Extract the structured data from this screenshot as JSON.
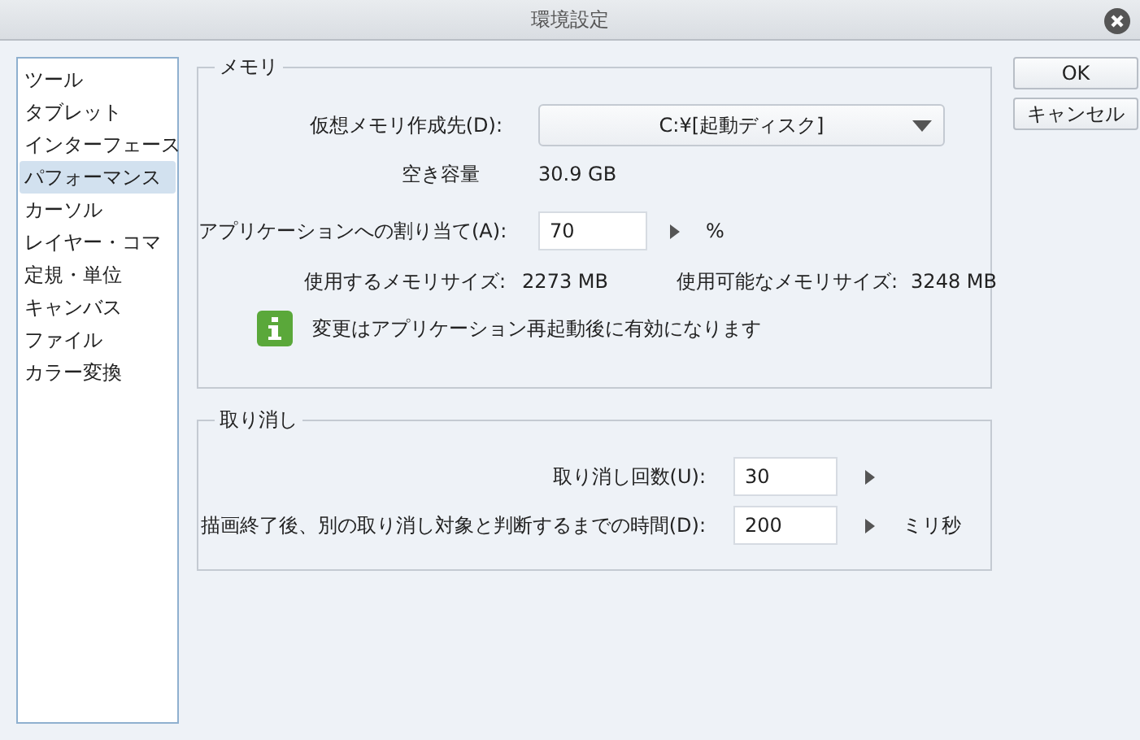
{
  "window": {
    "title": "環境設定"
  },
  "sidebar": {
    "items": [
      {
        "label": "ツール",
        "selected": false
      },
      {
        "label": "タブレット",
        "selected": false
      },
      {
        "label": "インターフェース",
        "selected": false
      },
      {
        "label": "パフォーマンス",
        "selected": true
      },
      {
        "label": "カーソル",
        "selected": false
      },
      {
        "label": "レイヤー・コマ",
        "selected": false
      },
      {
        "label": "定規・単位",
        "selected": false
      },
      {
        "label": "キャンバス",
        "selected": false
      },
      {
        "label": "ファイル",
        "selected": false
      },
      {
        "label": "カラー変換",
        "selected": false
      }
    ]
  },
  "memory": {
    "title": "メモリ",
    "location_label": "仮想メモリ作成先(D):",
    "location_value": "C:¥[起動ディスク]",
    "free_label": "空き容量",
    "free_value": "30.9 GB",
    "alloc_label": "アプリケーションへの割り当て(A):",
    "alloc_value": "70",
    "alloc_unit": "%",
    "used_label": "使用するメモリサイズ:",
    "used_value": "2273 MB",
    "available_label": "使用可能なメモリサイズ:",
    "available_value": "3248 MB",
    "info": "変更はアプリケーション再起動後に有効になります"
  },
  "undo": {
    "title": "取り消し",
    "count_label": "取り消し回数(U):",
    "count_value": "30",
    "time_label": "描画終了後、別の取り消し対象と判断するまでの時間(D):",
    "time_value": "200",
    "time_unit": "ミリ秒"
  },
  "buttons": [
    "OK",
    "キャンセル"
  ]
}
